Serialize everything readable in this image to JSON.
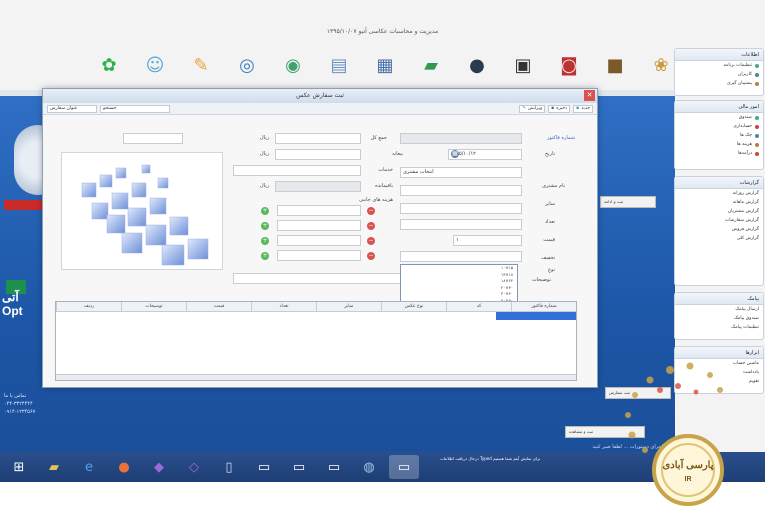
{
  "app": {
    "title": "مدیریت و محاسبات عکاسی آتیو ۱۳۹۵/۱۰/۰۷",
    "toolbar_icons": [
      "lifebuoy-icon",
      "people-icon",
      "folder-icon",
      "camera-icon",
      "palette-icon",
      "book-icon",
      "calendar-icon",
      "card-icon",
      "film-icon",
      "print-icon",
      "camera2-icon",
      "box-icon",
      "frame-icon"
    ]
  },
  "desktop": {
    "logo_lines": [
      "آتی",
      "Opt"
    ],
    "info_lines": [
      "تماس با ما",
      "۰۴۴-۳۳۲۴۴۴۴",
      "۰۹۱۴-۱۲۳۴۵۶۷"
    ],
    "status": "آماده اجرای دستورات ... لطفا صبر کنید"
  },
  "dialog": {
    "title": "ثبت سفارش عکس",
    "close": "✕",
    "toolbar": {
      "new": "جدید",
      "save": "ذخیره",
      "edit": "ویرایش",
      "search_placeholder": "جستجو",
      "search2_placeholder": "عنوان سفارش"
    },
    "form": {
      "order_no_label": "شماره فاکتور",
      "date_label": "تاریخ",
      "date_value": "۱۳۹۵/۱۰/۱۲",
      "customer_label": "نام مشتری",
      "customer_value": "انتخاب مشتری",
      "size_label": "سایز",
      "count_label": "تعداد",
      "price_label": "قیمت",
      "discount_label": "تخفیف",
      "type_label": "نوع",
      "desc_label": "توضیحات",
      "deposit_label": "بیعانه",
      "remaining_label": "باقیمانده",
      "total_label": "جمع کل",
      "services_label": "خدمات",
      "extra_label": "هزینه های جانبی",
      "currency": "ریال",
      "qty_value": "۱"
    },
    "dropdown": {
      "items": [
        "۱۰×۱۵",
        "۱۳×۱۸",
        "۱۸×۲۴",
        "۲۰×۳۰",
        "۳۰×۴۰",
        "۴۰×۵۰",
        "۵۰×۷۰",
        "۷۰×۱۰۰",
        "۱۰۰×۱۲۰"
      ],
      "selected_index": 8
    },
    "table": {
      "columns": [
        "ردیف",
        "توضیحات",
        "قیمت",
        "تعداد",
        "سایز",
        "نوع عکس",
        "کد",
        "شماره فاکتور"
      ]
    }
  },
  "sidebar": {
    "panels": [
      {
        "title": "اطلاعات",
        "items": [
          "تنظیمات برنامه",
          "کاربران",
          "پشتیبان گیری"
        ]
      },
      {
        "title": "امور مالی",
        "items": [
          "صندوق",
          "حسابداری",
          "چک ها",
          "هزینه ها",
          "درآمدها"
        ]
      },
      {
        "title": "گزارشات",
        "items": [
          "گزارش روزانه",
          "گزارش ماهانه",
          "گزارش مشتریان",
          "گزارش سفارشات",
          "گزارش فروش",
          "گزارش کلی"
        ]
      },
      {
        "title": "پیامک",
        "items": [
          "ارسال پیامک",
          "صندوق پیامک",
          "تنظیمات پیامک"
        ]
      },
      {
        "title": "ابزارها",
        "items": [
          "ماشین حساب",
          "یادداشت",
          "تقویم"
        ]
      }
    ]
  },
  "taskbar": {
    "items": [
      "start-icon",
      "folder-icon",
      "ie-icon",
      "firefox-icon",
      "vs-icon",
      "vs2-icon",
      "doc-icon",
      "window-icon",
      "window2-icon",
      "window3-icon",
      "app-icon",
      "app2-icon"
    ],
    "tray_text": "درحال دریافت اطلاعات Typed برای نمایش آیتم شما هستیم"
  },
  "watermark": {
    "text": "پارسی آبادی",
    "sub": "IR"
  },
  "colors": {
    "desktop_blue": "#1d57a8",
    "selection": "#2f6fd6",
    "remove": "#d9534f",
    "add": "#5cb85c"
  }
}
